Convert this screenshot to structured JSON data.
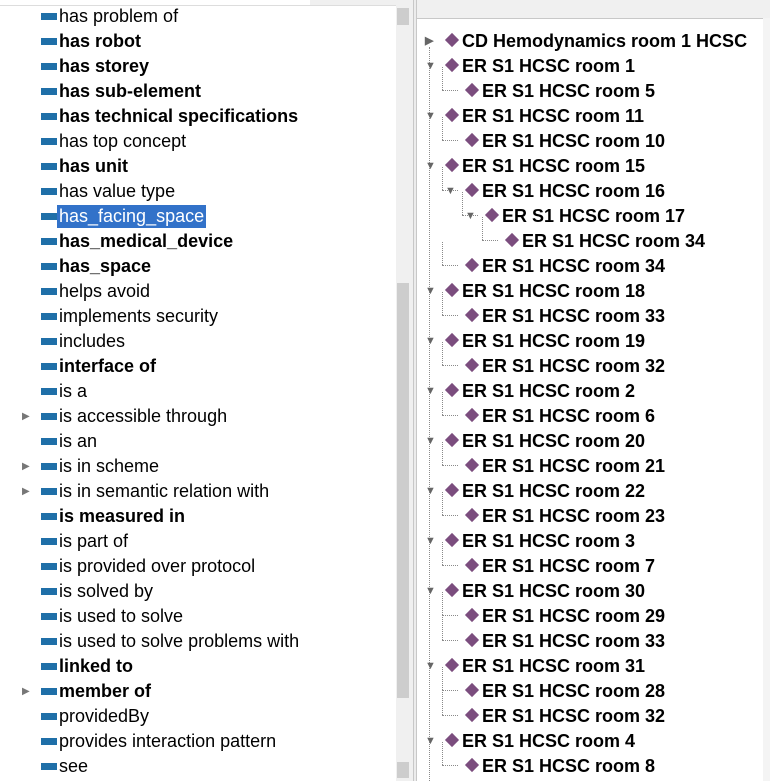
{
  "left_tree": {
    "items": [
      {
        "label": "has problem of",
        "bold": false,
        "expandable": false,
        "selected": false
      },
      {
        "label": "has robot",
        "bold": true,
        "expandable": false,
        "selected": false
      },
      {
        "label": "has storey",
        "bold": true,
        "expandable": false,
        "selected": false
      },
      {
        "label": "has sub-element",
        "bold": true,
        "expandable": false,
        "selected": false
      },
      {
        "label": "has technical specifications",
        "bold": true,
        "expandable": false,
        "selected": false
      },
      {
        "label": "has top concept",
        "bold": false,
        "expandable": false,
        "selected": false
      },
      {
        "label": "has unit",
        "bold": true,
        "expandable": false,
        "selected": false
      },
      {
        "label": "has value type",
        "bold": false,
        "expandable": false,
        "selected": false
      },
      {
        "label": "has_facing_space",
        "bold": false,
        "expandable": false,
        "selected": true
      },
      {
        "label": "has_medical_device",
        "bold": true,
        "expandable": false,
        "selected": false
      },
      {
        "label": "has_space",
        "bold": true,
        "expandable": false,
        "selected": false
      },
      {
        "label": "helps avoid",
        "bold": false,
        "expandable": false,
        "selected": false
      },
      {
        "label": "implements security",
        "bold": false,
        "expandable": false,
        "selected": false
      },
      {
        "label": "includes",
        "bold": false,
        "expandable": false,
        "selected": false
      },
      {
        "label": "interface of",
        "bold": true,
        "expandable": false,
        "selected": false
      },
      {
        "label": "is a",
        "bold": false,
        "expandable": false,
        "selected": false
      },
      {
        "label": "is accessible through",
        "bold": false,
        "expandable": true,
        "selected": false
      },
      {
        "label": "is an",
        "bold": false,
        "expandable": false,
        "selected": false
      },
      {
        "label": "is in scheme",
        "bold": false,
        "expandable": true,
        "selected": false
      },
      {
        "label": "is in semantic relation with",
        "bold": false,
        "expandable": true,
        "selected": false
      },
      {
        "label": "is measured in",
        "bold": true,
        "expandable": false,
        "selected": false
      },
      {
        "label": "is part of",
        "bold": false,
        "expandable": false,
        "selected": false
      },
      {
        "label": "is provided over protocol",
        "bold": false,
        "expandable": false,
        "selected": false
      },
      {
        "label": "is solved by",
        "bold": false,
        "expandable": false,
        "selected": false
      },
      {
        "label": "is used to solve",
        "bold": false,
        "expandable": false,
        "selected": false
      },
      {
        "label": "is used to solve problems with",
        "bold": false,
        "expandable": false,
        "selected": false
      },
      {
        "label": "linked to",
        "bold": true,
        "expandable": false,
        "selected": false
      },
      {
        "label": "member of",
        "bold": true,
        "expandable": true,
        "selected": false
      },
      {
        "label": "providedBy",
        "bold": false,
        "expandable": false,
        "selected": false
      },
      {
        "label": "provides interaction pattern",
        "bold": false,
        "expandable": false,
        "selected": false
      },
      {
        "label": "see",
        "bold": false,
        "expandable": false,
        "selected": false
      }
    ]
  },
  "right_tree": {
    "items": [
      {
        "label": "CD Hemodynamics room 1 HCSC",
        "depth": 0,
        "toggle": "collapsed"
      },
      {
        "label": "ER S1 HCSC room 1",
        "depth": 0,
        "toggle": "expanded"
      },
      {
        "label": "ER S1 HCSC room 5",
        "depth": 1,
        "toggle": "none"
      },
      {
        "label": "ER S1 HCSC room 11",
        "depth": 0,
        "toggle": "expanded"
      },
      {
        "label": "ER S1 HCSC room 10",
        "depth": 1,
        "toggle": "none"
      },
      {
        "label": "ER S1 HCSC room 15",
        "depth": 0,
        "toggle": "expanded"
      },
      {
        "label": "ER S1 HCSC room 16",
        "depth": 1,
        "toggle": "expanded"
      },
      {
        "label": "ER S1 HCSC room 17",
        "depth": 2,
        "toggle": "expanded"
      },
      {
        "label": "ER S1 HCSC room 34",
        "depth": 3,
        "toggle": "none"
      },
      {
        "label": "ER S1 HCSC room 34",
        "depth": 1,
        "toggle": "none"
      },
      {
        "label": "ER S1 HCSC room 18",
        "depth": 0,
        "toggle": "expanded"
      },
      {
        "label": "ER S1 HCSC room 33",
        "depth": 1,
        "toggle": "none"
      },
      {
        "label": "ER S1 HCSC room 19",
        "depth": 0,
        "toggle": "expanded"
      },
      {
        "label": "ER S1 HCSC room 32",
        "depth": 1,
        "toggle": "none"
      },
      {
        "label": "ER S1 HCSC room 2",
        "depth": 0,
        "toggle": "expanded"
      },
      {
        "label": "ER S1 HCSC room 6",
        "depth": 1,
        "toggle": "none"
      },
      {
        "label": "ER S1 HCSC room 20",
        "depth": 0,
        "toggle": "expanded"
      },
      {
        "label": "ER S1 HCSC room 21",
        "depth": 1,
        "toggle": "none"
      },
      {
        "label": "ER S1 HCSC room 22",
        "depth": 0,
        "toggle": "expanded"
      },
      {
        "label": "ER S1 HCSC room 23",
        "depth": 1,
        "toggle": "none"
      },
      {
        "label": "ER S1 HCSC room 3",
        "depth": 0,
        "toggle": "expanded"
      },
      {
        "label": "ER S1 HCSC room 7",
        "depth": 1,
        "toggle": "none"
      },
      {
        "label": "ER S1 HCSC room 30",
        "depth": 0,
        "toggle": "expanded"
      },
      {
        "label": "ER S1 HCSC room 29",
        "depth": 1,
        "toggle": "none"
      },
      {
        "label": "ER S1 HCSC room 33",
        "depth": 1,
        "toggle": "none"
      },
      {
        "label": "ER S1 HCSC room 31",
        "depth": 0,
        "toggle": "expanded"
      },
      {
        "label": "ER S1 HCSC room 28",
        "depth": 1,
        "toggle": "none"
      },
      {
        "label": "ER S1 HCSC room 32",
        "depth": 1,
        "toggle": "none"
      },
      {
        "label": "ER S1 HCSC room 4",
        "depth": 0,
        "toggle": "expanded"
      },
      {
        "label": "ER S1 HCSC room 8",
        "depth": 1,
        "toggle": "none"
      }
    ]
  },
  "colors": {
    "property_icon": "#1f6fa8",
    "individual_icon": "#7b4d7e",
    "selection": "#3272c9"
  },
  "icons": {
    "property": "object-property-icon",
    "individual": "individual-diamond-icon",
    "collapsed": "triangle-right-icon",
    "expanded": "triangle-down-icon"
  }
}
